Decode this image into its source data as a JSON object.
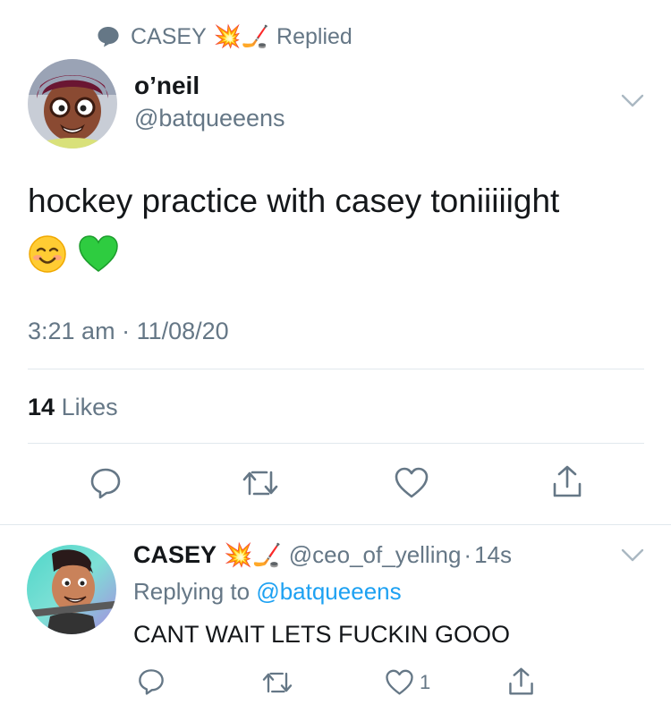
{
  "context": {
    "name": "CASEY",
    "emoji_1": "💥",
    "emoji_2": "🏒",
    "label": "Replied"
  },
  "main_tweet": {
    "display_name": "o’neil",
    "handle": "@batqueeens",
    "text": "hockey practice with casey toniiiiight",
    "emojis": [
      "😊",
      "💚"
    ],
    "time": "3:21 am",
    "separator": "·",
    "date": "11/08/20",
    "likes_count": "14",
    "likes_label": "Likes",
    "icons": [
      "reply-icon",
      "retweet-icon",
      "like-icon",
      "share-icon"
    ]
  },
  "reply_tweet": {
    "display_name": "CASEY",
    "emoji_1": "💥",
    "emoji_2": "🏒",
    "handle": "@ceo_of_yelling",
    "separator": "·",
    "age": "14s",
    "replying_prefix": "Replying to",
    "replying_to": "@batqueeens",
    "text": "CANT WAIT LETS FUCKIN GOOO",
    "like_count": "1"
  },
  "colors": {
    "text": "#14171a",
    "secondary": "#657786",
    "link": "#1da1f2",
    "divider": "#e1e8ed"
  }
}
